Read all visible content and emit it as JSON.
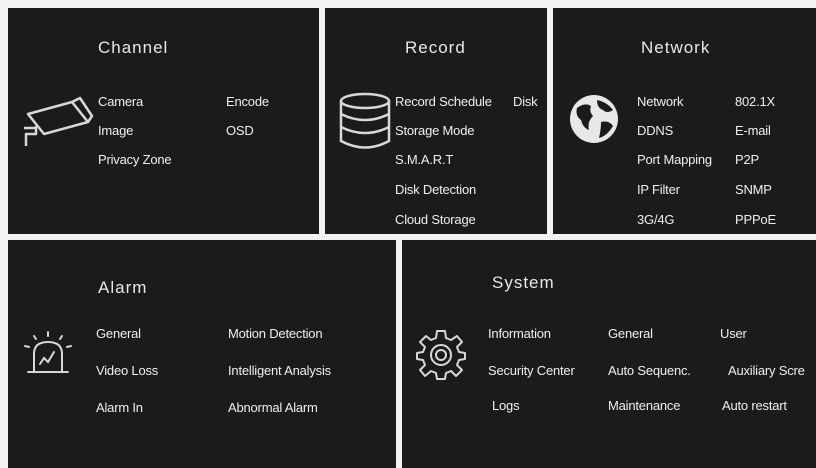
{
  "colors": {
    "panel": "#1b1b1b",
    "gap": "#f2f2f2",
    "text": "#efefef"
  },
  "channel": {
    "title": "Channel",
    "icon": "camera-icon",
    "items": [
      "Camera",
      "Encode",
      "Image",
      "OSD",
      "Privacy Zone"
    ]
  },
  "record": {
    "title": "Record",
    "icon": "database-icon",
    "items": [
      "Record Schedule",
      "Disk",
      "Storage Mode",
      "S.M.A.R.T",
      "Disk Detection",
      "Cloud Storage"
    ]
  },
  "network": {
    "title": "Network",
    "icon": "globe-icon",
    "items": [
      "Network",
      "802.1X",
      "DDNS",
      "E-mail",
      "Port Mapping",
      "P2P",
      "IP Filter",
      "SNMP",
      "3G/4G",
      "PPPoE"
    ]
  },
  "alarm": {
    "title": "Alarm",
    "icon": "alarm-siren-icon",
    "items": [
      "General",
      "Motion Detection",
      "Video Loss",
      "Intelligent Analysis",
      "Alarm In",
      "Abnormal Alarm"
    ]
  },
  "system": {
    "title": "System",
    "icon": "gear-icon",
    "items": [
      "Information",
      "General",
      "User",
      "Security Center",
      "Auto Sequenc.",
      "Auxiliary Scre",
      "Logs",
      "Maintenance",
      "Auto restart"
    ]
  }
}
